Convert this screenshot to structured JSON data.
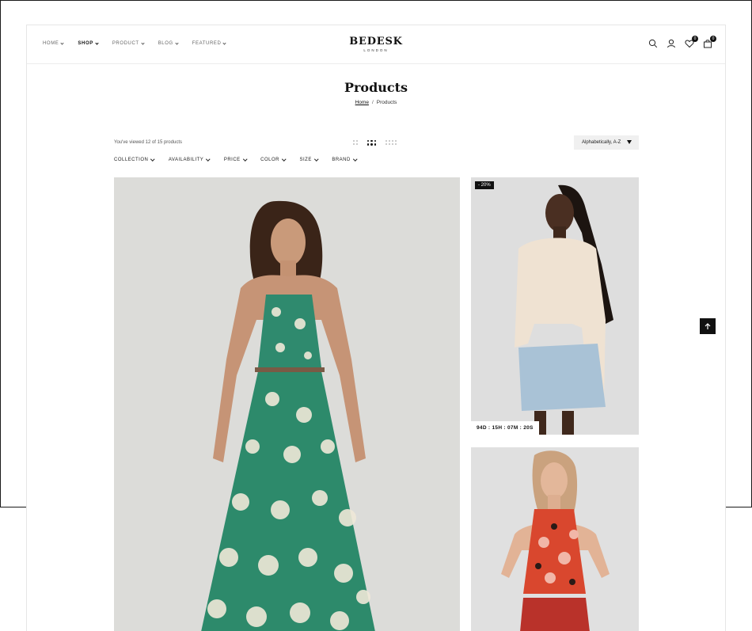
{
  "nav": {
    "items": [
      {
        "label": "HOME"
      },
      {
        "label": "SHOP"
      },
      {
        "label": "PRODUCT"
      },
      {
        "label": "BLOG"
      },
      {
        "label": "FEATURED"
      }
    ]
  },
  "brand": {
    "name": "BEDESK",
    "sub": "LONDON"
  },
  "header_icons": {
    "wishlist_count": "0",
    "cart_count": "0"
  },
  "page": {
    "title": "Products"
  },
  "breadcrumb": {
    "home": "Home",
    "separator": "/",
    "current": "Products"
  },
  "toolbar": {
    "count_text": "You've viewed 12 of 15 products",
    "sort_selected": "Alphabetically, A-Z"
  },
  "filters": [
    {
      "label": "COLLECTION"
    },
    {
      "label": "AVAILABILITY"
    },
    {
      "label": "PRICE"
    },
    {
      "label": "COLOR"
    },
    {
      "label": "SIZE"
    },
    {
      "label": "BRAND"
    }
  ],
  "products": [
    {
      "name": "Green floral halter maxi dress"
    },
    {
      "name": "Knit sweater with denim skirt",
      "badge": "- 20%",
      "countdown": "94D : 15H : 07M : 20S"
    },
    {
      "name": "Floral halter crop top"
    }
  ],
  "colors": {
    "accent": "#111111",
    "sort_bg": "#f0f0f0"
  }
}
